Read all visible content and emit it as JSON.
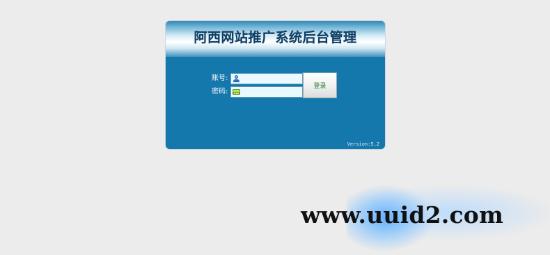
{
  "panel": {
    "title": "阿西网站推广系统后台管理",
    "version": "Version:5.2"
  },
  "form": {
    "username_label": "账号:",
    "password_label": "密码:",
    "username_value": "",
    "password_value": "",
    "username_icon": "user-icon",
    "password_icon": "key-icon",
    "login_label": "登录"
  },
  "watermark": {
    "text": "www.uuid2.com"
  },
  "colors": {
    "background": "#ececec",
    "panel": "#1578ad",
    "title": "#0d3f66",
    "button_text": "#2a7d2a"
  }
}
